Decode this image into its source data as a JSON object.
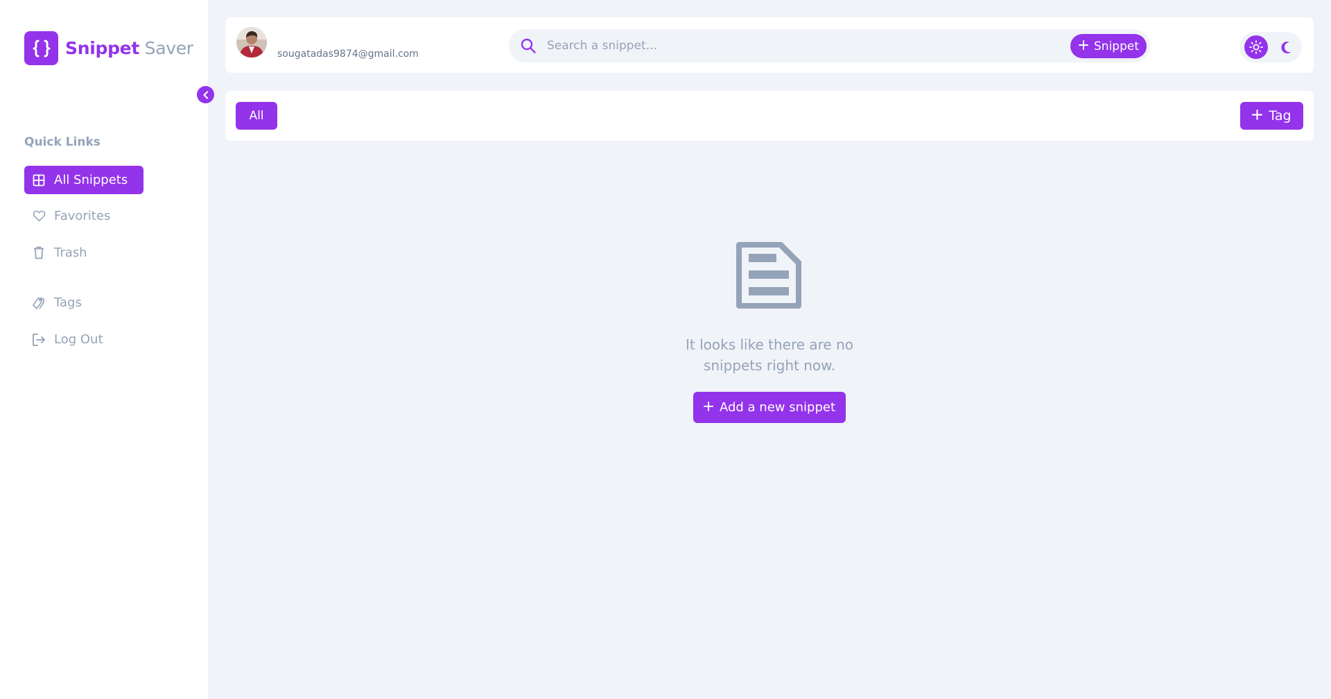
{
  "brand": {
    "name_bold": "Snippet",
    "name_light": "Saver",
    "icon": "curly-braces-icon",
    "accent": "#9333ea"
  },
  "sidebar": {
    "section_title": "Quick Links",
    "items": [
      {
        "label": "All Snippets",
        "icon": "grid-icon",
        "active": true
      },
      {
        "label": "Favorites",
        "icon": "heart-icon",
        "active": false
      },
      {
        "label": "Trash",
        "icon": "trash-icon",
        "active": false
      },
      {
        "label": "Tags",
        "icon": "tags-icon",
        "active": false
      },
      {
        "label": "Log Out",
        "icon": "logout-icon",
        "active": false
      }
    ]
  },
  "header": {
    "user_email": "sougatadas9874@gmail.com",
    "search_placeholder": "Search a snippet...",
    "add_snippet_label": "Snippet"
  },
  "tags": {
    "all_label": "All",
    "add_tag_label": "Tag"
  },
  "empty_state": {
    "message_line1": "It looks like there are no",
    "message_line2": "snippets right now.",
    "button_label": "Add a new snippet"
  }
}
